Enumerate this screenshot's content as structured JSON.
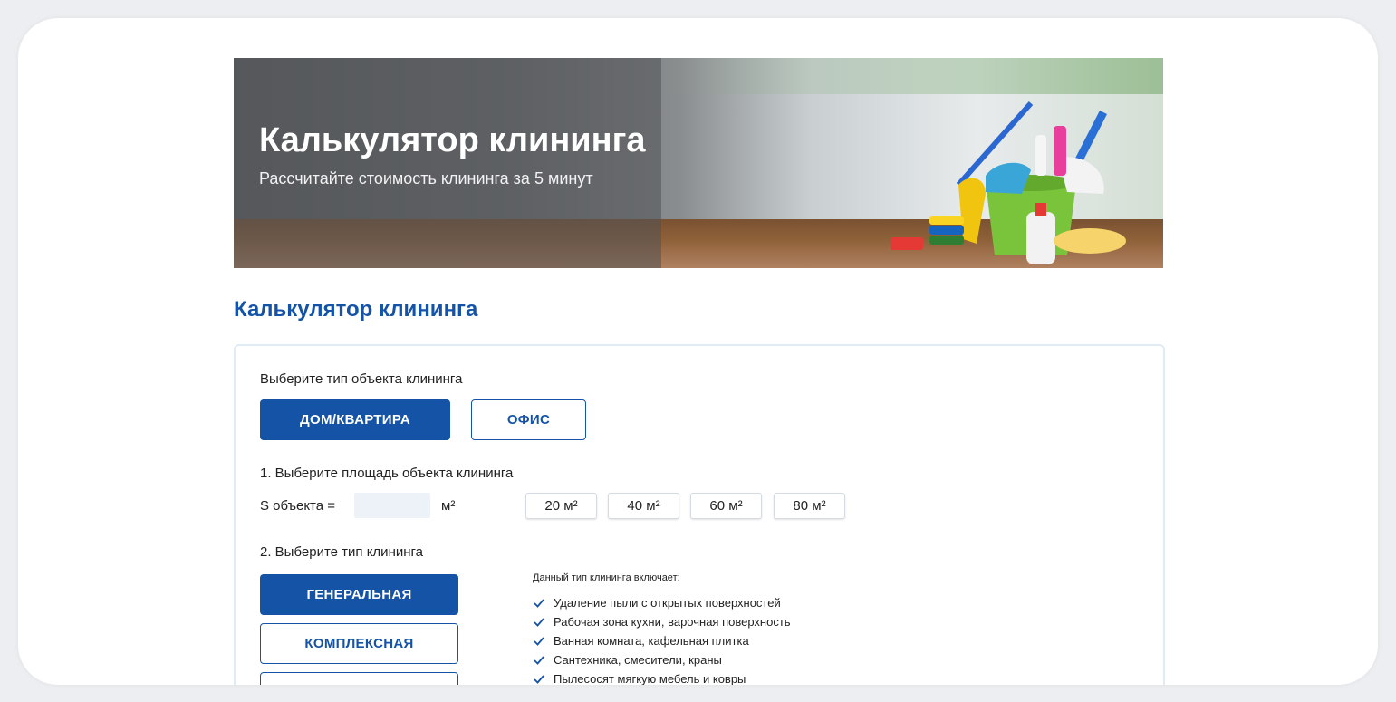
{
  "hero": {
    "title": "Калькулятор клининга",
    "subtitle": "Рассчитайте стоимость клининга за 5 минут"
  },
  "section_title": "Калькулятор клининга",
  "object_type": {
    "label": "Выберите тип объекта клининга",
    "options": [
      "ДОМ/КВАРТИРА",
      "ОФИС"
    ],
    "selected": "ДОМ/КВАРТИРА"
  },
  "area": {
    "label": "1. Выберите площадь объекта клининга",
    "prefix": "S объекта =",
    "unit": "м²",
    "value": "",
    "presets": [
      "20 м²",
      "40 м²",
      "60 м²",
      "80 м²"
    ]
  },
  "cleaning_type": {
    "label": "2. Выберите тип клининга",
    "options": [
      "ГЕНЕРАЛЬНАЯ",
      "КОМПЛЕКСНАЯ"
    ],
    "selected": "ГЕНЕРАЛЬНАЯ"
  },
  "features": {
    "title": "Данный тип клининга включает:",
    "items": [
      "Удаление пыли с открытых поверхностей",
      "Рабочая зона кухни, варочная поверхность",
      "Ванная комната, кафельная плитка",
      "Сантехника, смесители, краны",
      "Пылесосят мягкую мебель и ковры"
    ]
  },
  "colors": {
    "accent": "#1553a6",
    "input_bg": "#edf2f9",
    "panel_border": "#e1ebf5"
  }
}
